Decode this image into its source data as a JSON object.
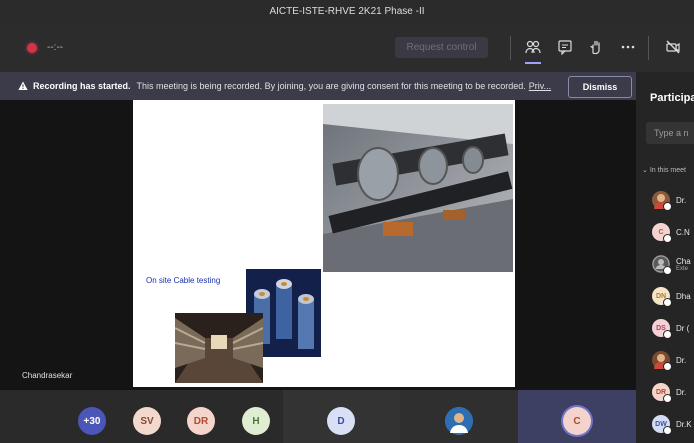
{
  "window": {
    "title": "AICTE-ISTE-RHVE 2K21 Phase -II"
  },
  "toolbar": {
    "timer": "--:--",
    "request_control": "Request control",
    "icons": [
      "people-icon",
      "chat-icon",
      "raise-hand-icon",
      "more-icon",
      "camera-off-icon"
    ]
  },
  "banner": {
    "title": "Recording has started.",
    "message": "This meeting is being recorded. By joining, you are giving consent for this meeting to be recorded.",
    "link": "Priv...",
    "dismiss": "Dismiss"
  },
  "slide": {
    "caption": "On site Cable testing"
  },
  "presenter": {
    "name": "Chandrasekar"
  },
  "sidebar": {
    "title": "Participa",
    "search_placeholder": "Type a n",
    "section": "In this meet",
    "participants": [
      {
        "initials": "",
        "name": "Dr.",
        "type": "photo",
        "color": "#8b5a3c"
      },
      {
        "initials": "C",
        "name": "C.N",
        "type": "initials",
        "color": "#f2d3d0",
        "fg": "#b6524a"
      },
      {
        "initials": "",
        "name": "Cha",
        "sub": "Exte",
        "type": "generic",
        "color": "#5a5a5a"
      },
      {
        "initials": "DN",
        "name": "Dha",
        "type": "initials",
        "color": "#f5e4c8",
        "fg": "#b27a2c"
      },
      {
        "initials": "DS",
        "name": "Dr (",
        "type": "initials",
        "color": "#f4d1d8",
        "fg": "#b2415a"
      },
      {
        "initials": "",
        "name": "Dr.",
        "type": "photo",
        "color": "#7a4a2e"
      },
      {
        "initials": "DR",
        "name": "Dr.",
        "type": "initials",
        "color": "#f4d5cc",
        "fg": "#b04a30"
      },
      {
        "initials": "DW",
        "name": "Dr.K",
        "type": "initials",
        "color": "#d3dcf5",
        "fg": "#3b53a6"
      }
    ]
  },
  "bottom": {
    "avatars": [
      {
        "label": "+30",
        "color": "#4a56b8",
        "fg": "#ffffff"
      },
      {
        "label": "SV",
        "color": "#f3d8cd",
        "fg": "#8a4a2c"
      },
      {
        "label": "DR",
        "color": "#f4d5cc",
        "fg": "#b04a30"
      },
      {
        "label": "H",
        "color": "#dfeed2",
        "fg": "#4d7a2e"
      }
    ],
    "tiles": [
      {
        "label": "D",
        "color": "#d9dff5",
        "fg": "#3a4f9a"
      },
      {
        "label": "",
        "color": "#2e6fb3",
        "fg": "#ffffff"
      },
      {
        "label": "C",
        "color": "#f3d3cb",
        "fg": "#b04a30"
      }
    ]
  }
}
